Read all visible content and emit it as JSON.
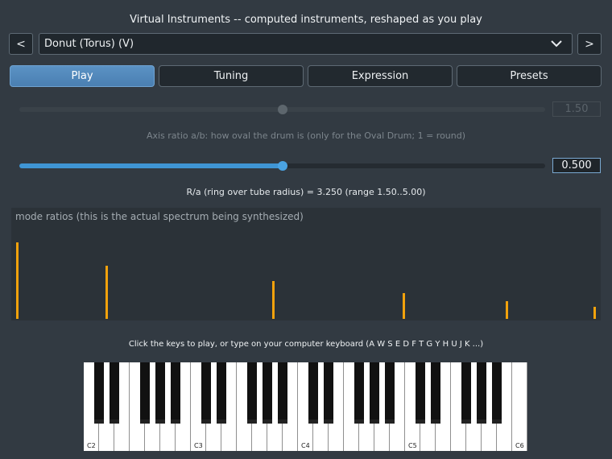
{
  "window": {
    "title": "Virtual Instruments -- computed instruments, reshaped as you play"
  },
  "nav": {
    "prev_label": "<",
    "next_label": ">"
  },
  "instrument_select": {
    "selected": "Donut (Torus) (V)"
  },
  "tabs": [
    {
      "label": "Play",
      "active": true
    },
    {
      "label": "Tuning",
      "active": false
    },
    {
      "label": "Expression",
      "active": false
    },
    {
      "label": "Presets",
      "active": false
    }
  ],
  "sliders": {
    "axis_ratio": {
      "value_text": "1.50",
      "fraction": 0.5,
      "enabled": false,
      "caption": "Axis ratio a/b: how oval the drum is (only for the Oval Drum; 1 = round)"
    },
    "ring_ratio": {
      "value_text": "0.500",
      "fraction": 0.5,
      "enabled": true,
      "caption": "R/a (ring over tube radius) = 3.250 (range 1.50..5.00)"
    }
  },
  "spectrum": {
    "label": "mode ratios (this is the actual spectrum being synthesized)",
    "bar_color": "#f2a20c",
    "modes": [
      {
        "ratio": 1.0,
        "amplitude": 1.0
      },
      {
        "ratio": 1.46,
        "amplitude": 0.7
      },
      {
        "ratio": 2.95,
        "amplitude": 0.49
      },
      {
        "ratio": 5.11,
        "amplitude": 0.34
      },
      {
        "ratio": 7.88,
        "amplitude": 0.23
      },
      {
        "ratio": 11.4,
        "amplitude": 0.16
      }
    ]
  },
  "keyboard": {
    "caption": "Click the keys to play, or type on your computer keyboard (A W S E D F T G Y H U J K ...)",
    "octave_labels": [
      "C2",
      "C3",
      "C4",
      "C5",
      "C6"
    ],
    "white_key_count": 29
  },
  "colors": {
    "background": "#323a42",
    "accent": "#4a85bd",
    "slider_fill": "#3f95d4",
    "spectrum_bar": "#f2a20c"
  }
}
